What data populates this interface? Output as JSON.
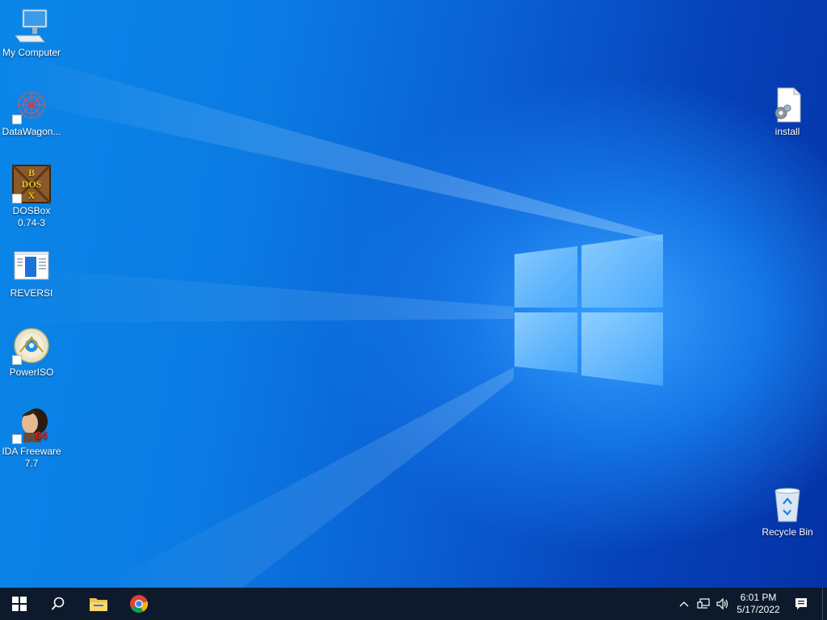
{
  "desktop_icons": {
    "my_computer": "My Computer",
    "datawagon": "DataWagon...",
    "dosbox_line1": "DOSBox",
    "dosbox_line2": "0.74-3",
    "reversi": "REVERSI",
    "poweriso": "PowerISO",
    "ida_line1": "IDA Freeware",
    "ida_line2": "7.7",
    "install": "install",
    "recycle_bin": "Recycle Bin"
  },
  "taskbar": {
    "time": "6:01 PM",
    "date": "5/17/2022"
  },
  "colors": {
    "taskbar": "#0c1a2c",
    "wallpaper_accent": "#1577e6"
  }
}
